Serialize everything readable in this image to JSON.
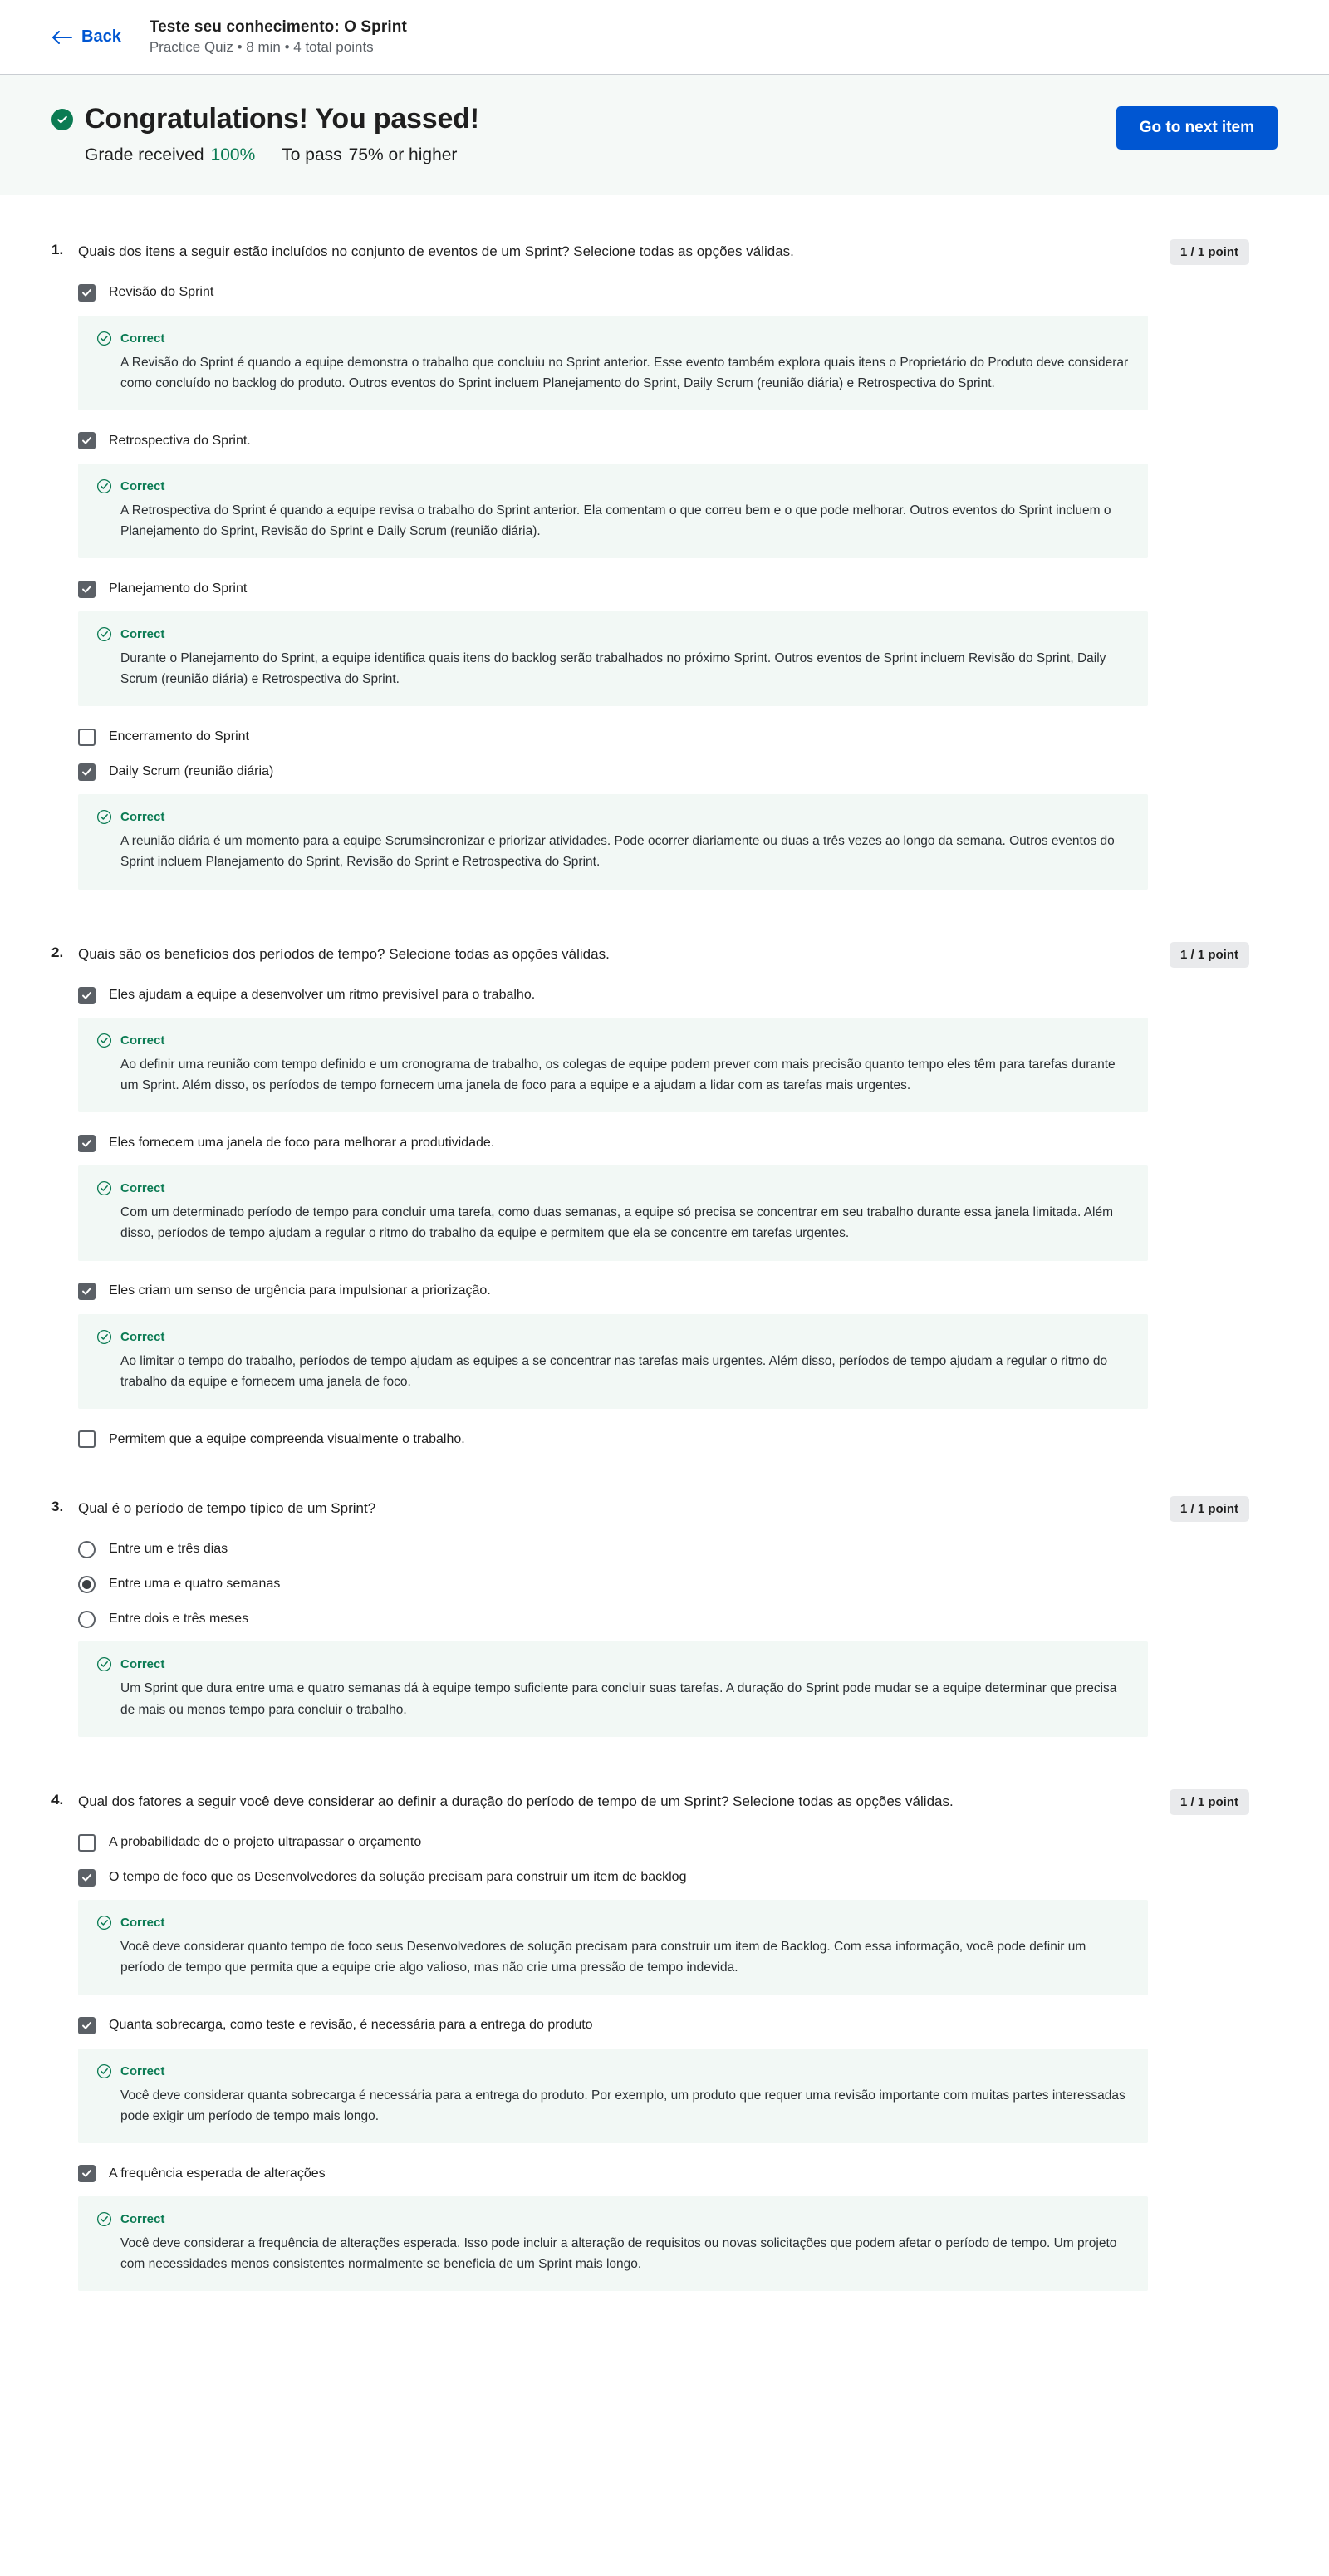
{
  "header": {
    "back_label": "Back",
    "quiz_title": "Teste seu conhecimento: O Sprint",
    "quiz_subtitle": "Practice Quiz • 8 min • 4 total points"
  },
  "banner": {
    "headline": "Congratulations! You passed!",
    "grade_label": "Grade received",
    "grade_value": "100%",
    "pass_label": "To pass",
    "pass_value": "75% or higher",
    "next_button": "Go to next item",
    "accent_green": "#0b7b53",
    "accent_blue": "#0056d2"
  },
  "feedback_label": "Correct",
  "questions": [
    {
      "number": "1.",
      "text": "Quais dos itens a seguir estão incluídos no conjunto de eventos de um Sprint? Selecione todas as opções válidas.",
      "points": "1 / 1 point",
      "input_type": "checkbox",
      "options": [
        {
          "label": "Revisão do Sprint",
          "state": "checked",
          "feedback": "A Revisão do Sprint é quando a equipe demonstra o trabalho que concluiu no Sprint anterior. Esse evento também explora quais itens o Proprietário do Produto deve considerar como concluído no backlog do produto. Outros eventos do Sprint incluem Planejamento do Sprint, Daily Scrum (reunião diária) e Retrospectiva do Sprint."
        },
        {
          "label": "Retrospectiva do Sprint.",
          "state": "checked",
          "feedback": "A Retrospectiva do Sprint é quando a equipe revisa o trabalho do Sprint anterior. Ela comentam o que correu bem e o que pode melhorar. Outros eventos do Sprint incluem o Planejamento do Sprint, Revisão do Sprint e Daily Scrum (reunião diária)."
        },
        {
          "label": "Planejamento do Sprint",
          "state": "checked",
          "feedback": "Durante o Planejamento do Sprint, a equipe identifica quais itens do backlog serão trabalhados no próximo Sprint. Outros eventos de Sprint incluem Revisão do Sprint, Daily Scrum (reunião diária) e Retrospectiva do Sprint."
        },
        {
          "label": "Encerramento do Sprint",
          "state": "unchecked",
          "feedback": ""
        },
        {
          "label": "Daily Scrum (reunião diária)",
          "state": "checked",
          "feedback": "A reunião diária é um momento para a equipe Scrumsincronizar e priorizar atividades. Pode ocorrer diariamente ou duas a três vezes ao longo da semana. Outros eventos do Sprint incluem Planejamento do Sprint, Revisão do Sprint e Retrospectiva do Sprint."
        }
      ]
    },
    {
      "number": "2.",
      "text": "Quais são os benefícios dos períodos de tempo? Selecione todas as opções válidas.",
      "points": "1 / 1 point",
      "input_type": "checkbox",
      "options": [
        {
          "label": "Eles ajudam a equipe a desenvolver um ritmo previsível para o trabalho.",
          "state": "checked",
          "feedback": "Ao definir uma reunião com tempo definido e um cronograma de trabalho, os colegas de equipe podem prever com mais precisão quanto tempo eles têm para tarefas durante um Sprint. Além disso, os períodos de tempo fornecem uma janela de foco para a equipe e a ajudam a lidar com as tarefas mais urgentes."
        },
        {
          "label": "Eles fornecem uma janela de foco para melhorar a produtividade.",
          "state": "checked",
          "feedback": "Com um determinado período de tempo para concluir uma tarefa, como duas semanas, a equipe só precisa se concentrar em seu trabalho durante essa janela limitada. Além disso, períodos de tempo ajudam a regular o ritmo do trabalho da equipe e permitem que ela se concentre em tarefas urgentes."
        },
        {
          "label": "Eles criam um senso de urgência para impulsionar a priorização.",
          "state": "checked",
          "feedback": "Ao limitar o tempo do trabalho, períodos de tempo ajudam as equipes a se concentrar nas tarefas mais urgentes. Além disso, períodos de tempo ajudam a regular o ritmo do trabalho da equipe e fornecem uma janela de foco."
        },
        {
          "label": "Permitem que a equipe compreenda visualmente o trabalho.",
          "state": "unchecked",
          "feedback": ""
        }
      ]
    },
    {
      "number": "3.",
      "text": "Qual é o período de tempo típico de um Sprint?",
      "points": "1 / 1 point",
      "input_type": "radio",
      "options": [
        {
          "label": "Entre um e três dias",
          "state": "unchecked",
          "feedback": ""
        },
        {
          "label": "Entre uma e quatro semanas",
          "state": "checked",
          "feedback": "Um Sprint que dura entre uma e quatro semanas dá à equipe tempo suficiente para concluir suas tarefas. A duração do Sprint pode mudar se a equipe determinar que precisa de mais ou menos tempo para concluir o trabalho."
        },
        {
          "label": "Entre dois e três meses",
          "state": "unchecked",
          "feedback": ""
        }
      ],
      "feedback_after_options": true
    },
    {
      "number": "4.",
      "text": "Qual dos fatores a seguir você deve considerar ao definir a duração do período de tempo de um Sprint? Selecione todas as opções válidas.",
      "points": "1 / 1 point",
      "input_type": "checkbox",
      "options": [
        {
          "label": "A probabilidade de o projeto ultrapassar o orçamento",
          "state": "unchecked",
          "feedback": ""
        },
        {
          "label": "O tempo de foco que os Desenvolvedores da solução precisam para construir um item de backlog",
          "state": "checked",
          "feedback": "Você deve considerar quanto tempo de foco seus Desenvolvedores de solução precisam para construir um item de Backlog. Com essa informação, você pode definir um período de tempo que permita que a equipe crie algo valioso, mas não crie uma pressão de tempo indevida."
        },
        {
          "label": "Quanta sobrecarga, como teste e revisão, é necessária para a entrega do produto",
          "state": "checked",
          "feedback": "Você deve considerar quanta sobrecarga é necessária para a entrega do produto. Por exemplo, um produto que requer uma revisão importante com muitas partes interessadas pode exigir um período de tempo mais longo."
        },
        {
          "label": "A frequência esperada de alterações",
          "state": "checked",
          "feedback": "Você deve considerar a frequência de alterações esperada. Isso pode incluir a alteração de requisitos ou novas solicitações que podem afetar o período de tempo. Um projeto com necessidades menos consistentes normalmente se beneficia de um Sprint mais longo."
        }
      ]
    }
  ]
}
